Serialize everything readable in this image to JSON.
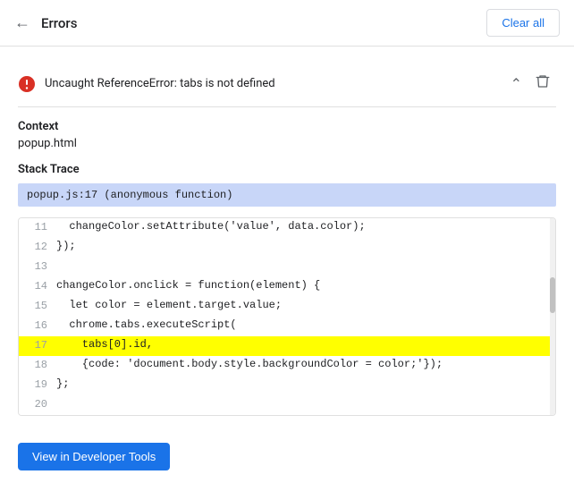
{
  "header": {
    "back_icon": "←",
    "title": "Errors",
    "clear_all_label": "Clear all"
  },
  "error": {
    "message": "Uncaught ReferenceError: tabs is not defined",
    "context_label": "Context",
    "context_value": "popup.html",
    "stack_trace_label": "Stack Trace",
    "stack_trace_line": "popup.js:17 (anonymous function)"
  },
  "code": {
    "lines": [
      {
        "number": "11",
        "content": "  changeColor.setAttribute('value', data.color);",
        "highlighted": false
      },
      {
        "number": "12",
        "content": "});",
        "highlighted": false
      },
      {
        "number": "13",
        "content": "",
        "highlighted": false
      },
      {
        "number": "14",
        "content": "changeColor.onclick = function(element) {",
        "highlighted": false
      },
      {
        "number": "15",
        "content": "  let color = element.target.value;",
        "highlighted": false
      },
      {
        "number": "16",
        "content": "  chrome.tabs.executeScript(",
        "highlighted": false
      },
      {
        "number": "17",
        "content": "    tabs[0].id,",
        "highlighted": true
      },
      {
        "number": "18",
        "content": "    {code: 'document.body.style.backgroundColor = color;'});",
        "highlighted": false
      },
      {
        "number": "19",
        "content": "};",
        "highlighted": false
      },
      {
        "number": "20",
        "content": "",
        "highlighted": false
      }
    ]
  },
  "footer": {
    "view_devtools_label": "View in Developer Tools"
  }
}
